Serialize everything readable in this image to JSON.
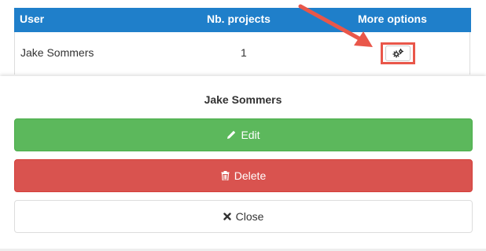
{
  "table": {
    "headers": [
      "User",
      "Nb. projects",
      "More options"
    ],
    "rows": [
      {
        "user": "Jake Sommers",
        "projects": "1"
      }
    ]
  },
  "sheet": {
    "title": "Jake Sommers",
    "edit_label": "Edit",
    "delete_label": "Delete",
    "close_label": "Close"
  },
  "icons": {
    "options": "cogs-icon",
    "edit": "pencil-icon",
    "delete": "trash-icon",
    "close": "times-icon",
    "callout": "arrow-icon"
  },
  "colors": {
    "header_bg": "#1f7fca",
    "edit_bg": "#5cb85c",
    "delete_bg": "#d9534f",
    "highlight": "#e9574a"
  }
}
